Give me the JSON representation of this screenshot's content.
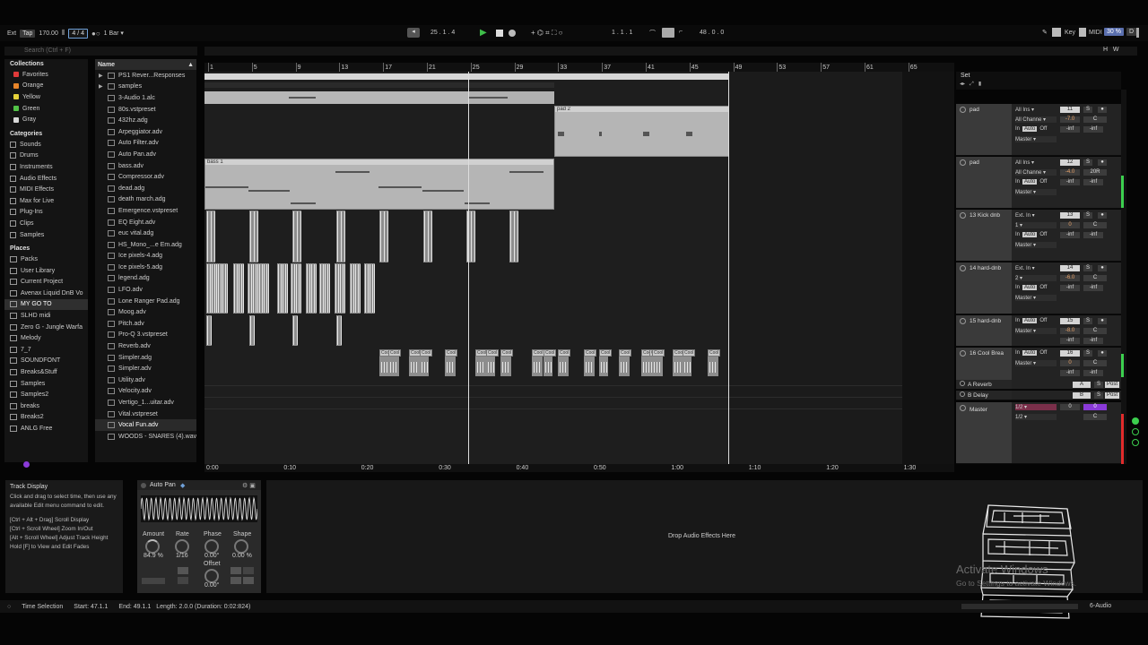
{
  "transport": {
    "ext": "Ext",
    "tap": "Tap",
    "tempo": "170.00",
    "signature": "4 / 4",
    "quantize": "1 Bar",
    "position": "25 .  1 .  4",
    "loop_start": "1 .  1 .  1",
    "loop_length": "48 .  0 .  0",
    "key": "Key",
    "midi": "MIDI",
    "cpu": "30 %",
    "d": "D"
  },
  "browser": {
    "search_placeholder": "Search (Ctrl + F)",
    "collections_title": "Collections",
    "collections": [
      {
        "label": "Favorites",
        "color": "#e03a3a"
      },
      {
        "label": "Orange",
        "color": "#e8852a"
      },
      {
        "label": "Yellow",
        "color": "#e6d23a"
      },
      {
        "label": "Green",
        "color": "#52c247"
      },
      {
        "label": "Gray",
        "color": "#d8d8d8"
      }
    ],
    "categories_title": "Categories",
    "categories": [
      "Sounds",
      "Drums",
      "Instruments",
      "Audio Effects",
      "MIDI Effects",
      "Max for Live",
      "Plug-Ins",
      "Clips",
      "Samples"
    ],
    "places_title": "Places",
    "places": [
      "Packs",
      "User Library",
      "Current Project",
      "Avenax Liquid DnB Vo",
      "MY GO TO",
      "SLHD midi",
      "Zero G - Jungle Warfa",
      "Melody",
      "7_7",
      "SOUNDFONT",
      "Breaks&Stuff",
      "Samples",
      "Samples2",
      "breaks",
      "Breaks2",
      "ANLG Free"
    ],
    "name_header": "Name",
    "files": [
      "PS1 Rever...Responses",
      "samples",
      "3-Audio 1.alc",
      "80s.vstpreset",
      "432hz.adg",
      "Arpeggiator.adv",
      "Auto Filter.adv",
      "Auto Pan.adv",
      "bass.adv",
      "Compressor.adv",
      "dead.adg",
      "death march.adg",
      "Emergence.vstpreset",
      "EQ Eight.adv",
      "euc vital.adg",
      "HS_Mono_...e Em.adg",
      "Ice pixels-4.adg",
      "Ice pixels-5.adg",
      "legend.adg",
      "LFO.adv",
      "Lone Ranger Pad.adg",
      "Moog.adv",
      "Pitch.adv",
      "Pro-Q 3.vstpreset",
      "Reverb.adv",
      "Simpler.adg",
      "Simpler.adv",
      "Utility.adv",
      "Velocity.adv",
      "Vertigo_1...uitar.adv",
      "Vital.vstpreset",
      "Vocal Fun.adv",
      "WOODS - SNARES (4).wav"
    ]
  },
  "arrangement": {
    "bars": [
      "1",
      "5",
      "9",
      "13",
      "17",
      "21",
      "25",
      "29",
      "33",
      "37",
      "41",
      "45",
      "49",
      "53",
      "57",
      "61",
      "65"
    ],
    "times": [
      "0:00",
      "0:10",
      "0:20",
      "0:30",
      "0:40",
      "0:50",
      "1:00",
      "1:10",
      "1:20",
      "1:30"
    ],
    "clip_pad2": "pad 2",
    "clip_bass1": "bass 1",
    "cool_label": "Cool",
    "set_label": "Set"
  },
  "tracks": [
    {
      "name": "pad",
      "input": "All Ins",
      "channel": "All Channe",
      "num": "11",
      "vol": "-7.0",
      "pan": "C",
      "mon_in": "In",
      "mon_auto": "Auto",
      "mon_off": "Off",
      "out": "Master",
      "inf1": "-inf",
      "inf2": "-inf"
    },
    {
      "name": "pad",
      "input": "All Ins",
      "channel": "All Channe",
      "num": "12",
      "vol": "-4.0",
      "pan": "20R",
      "mon_in": "In",
      "mon_auto": "Auto",
      "mon_off": "Off",
      "out": "Master",
      "inf1": "-inf",
      "inf2": "-inf"
    },
    {
      "name": "13 Kick dnb",
      "input": "Ext. In",
      "channel": "1",
      "num": "13",
      "vol": "0",
      "pan": "C",
      "mon_in": "In",
      "mon_auto": "Auto",
      "mon_off": "Off",
      "out": "Master",
      "inf1": "-inf",
      "inf2": "-inf"
    },
    {
      "name": "14 hard-dnb",
      "input": "Ext. In",
      "channel": "2",
      "num": "14",
      "vol": "-6.0",
      "pan": "C",
      "mon_in": "In",
      "mon_auto": "Auto",
      "mon_off": "Off",
      "out": "Master",
      "inf1": "-inf",
      "inf2": "-inf"
    },
    {
      "name": "15 hard-dnb",
      "input": "",
      "channel": "",
      "num": "15",
      "vol": "-8.0",
      "pan": "C",
      "mon_in": "In",
      "mon_auto": "Auto",
      "mon_off": "Off",
      "out": "Master",
      "inf1": "-inf",
      "inf2": "-inf"
    },
    {
      "name": "16 Cool Brea",
      "input": "",
      "channel": "",
      "num": "16",
      "vol": "0",
      "pan": "C",
      "mon_in": "In",
      "mon_auto": "Auto",
      "mon_off": "Off",
      "out": "Master",
      "inf1": "-inf",
      "inf2": "-inf"
    }
  ],
  "returns": [
    {
      "name": "A Reverb",
      "letter": "A",
      "post": "Post"
    },
    {
      "name": "B Delay",
      "letter": "B",
      "post": "Post"
    }
  ],
  "master": {
    "name": "Master",
    "cue": "1/2",
    "main": "1/2",
    "vol": "0",
    "pan": "C",
    "zero": "0"
  },
  "info": {
    "title": "Track Display",
    "text1": "Click and drag to select time, then use any available Edit menu command to edit.",
    "text2": "[Ctrl + Alt + Drag] Scroll Display",
    "text3": "[Ctrl + Scroll Wheel] Zoom In/Out",
    "text4": "[Alt + Scroll Wheel] Adjust Track Height",
    "text5": "Hold [F] to View and Edit Fades"
  },
  "device": {
    "name": "Auto Pan",
    "amount_label": "Amount",
    "amount": "84.9 %",
    "rate_label": "Rate",
    "rate": "1/16",
    "phase_label": "Phase",
    "phase": "0.00°",
    "shape_label": "Shape",
    "shape": "0.00 %",
    "offset_label": "Offset",
    "offset": "0.00°",
    "drop_text": "Drop Audio Effects Here"
  },
  "watermark": {
    "line1": "Activate Windows",
    "line2": "Go to Settings to activate Windows."
  },
  "status": {
    "mode": "Time Selection",
    "start": "Start: 47.1.1",
    "end": "End: 49.1.1",
    "length": "Length: 2.0.0 (Duration: 0:02:824)",
    "track": "6-Audio"
  },
  "colors": {
    "accent": "#5a6fae",
    "meter_green": "#3ccf4e",
    "meter_red": "#e12b2b",
    "master_purple": "#8a3ad8"
  }
}
